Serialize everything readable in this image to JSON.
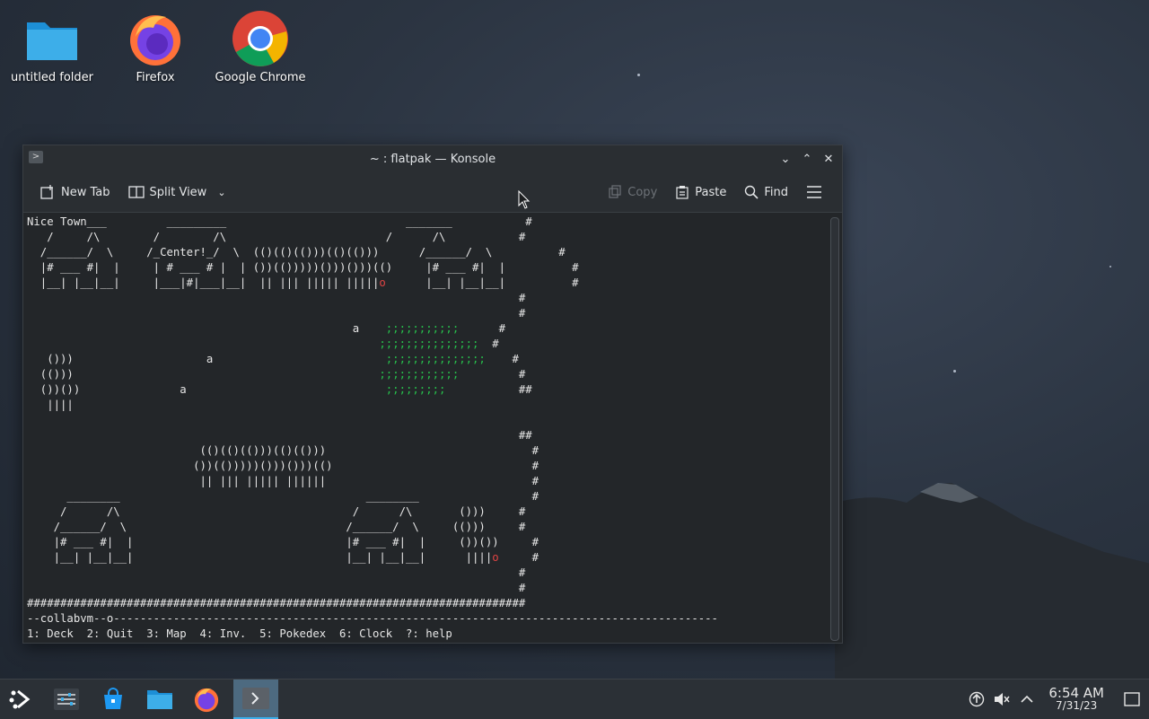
{
  "desktop": {
    "icons": [
      {
        "label": "untitled folder",
        "icon": "folder-icon"
      },
      {
        "label": "Firefox",
        "icon": "firefox-icon"
      },
      {
        "label": "Google Chrome",
        "icon": "chrome-icon"
      }
    ]
  },
  "window": {
    "title": "~ : flatpak — Konsole",
    "toolbar": {
      "new_tab": "New Tab",
      "split_view": "Split View",
      "copy": "Copy",
      "paste": "Paste",
      "find": "Find"
    }
  },
  "terminal": {
    "status_line": "--collabvm--o-------------------------------------------------------------------------------------------",
    "menu_line": "1: Deck  2: Quit  3: Map  4: Inv.  5: Pokedex  6: Clock  ?: help"
  },
  "taskbar": {
    "time": "6:54 AM",
    "date": "7/31/23"
  },
  "colors": {
    "terminal_bg": "#232629",
    "grass_green": "#27c24c",
    "accent_blue": "#3daee9"
  }
}
